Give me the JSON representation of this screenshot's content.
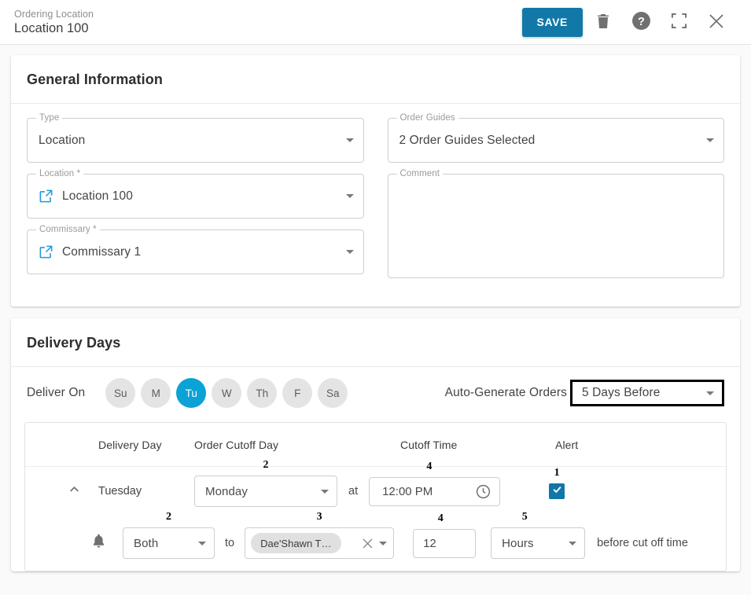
{
  "header": {
    "subtitle": "Ordering Location",
    "title": "Location 100",
    "save_label": "SAVE",
    "icons": {
      "delete": "trash-icon",
      "help": "help-icon",
      "fullscreen": "fullscreen-icon",
      "close": "close-icon"
    }
  },
  "general": {
    "section_title": "General Information",
    "type": {
      "label": "Type",
      "value": "Location"
    },
    "location": {
      "label": "Location *",
      "value": "Location 100"
    },
    "commissary": {
      "label": "Commissary *",
      "value": "Commissary 1"
    },
    "order_guides": {
      "label": "Order Guides",
      "value": "2 Order Guides Selected"
    },
    "comment": {
      "label": "Comment",
      "value": "",
      "placeholder": ""
    }
  },
  "delivery": {
    "section_title": "Delivery Days",
    "deliver_on_label": "Deliver On",
    "days": [
      {
        "label": "Su",
        "selected": false
      },
      {
        "label": "M",
        "selected": false
      },
      {
        "label": "Tu",
        "selected": true
      },
      {
        "label": "W",
        "selected": false
      },
      {
        "label": "Th",
        "selected": false
      },
      {
        "label": "F",
        "selected": false
      },
      {
        "label": "Sa",
        "selected": false
      }
    ],
    "auto_generate": {
      "label": "Auto-Generate Orders",
      "value": "5 Days Before"
    },
    "table": {
      "columns": [
        "Delivery Day",
        "Order Cutoff Day",
        "Cutoff Time",
        "Alert"
      ],
      "row": {
        "delivery_day": "Tuesday",
        "order_cutoff_day": "Monday",
        "at_text": "at",
        "cutoff_time": "12:00 PM",
        "alert_checked": true
      },
      "alert_row": {
        "method": "Both",
        "to_text": "to",
        "recipient_chip": "Dae'Shawn T…",
        "amount": "12",
        "unit": "Hours",
        "suffix_text": "before cut off time"
      }
    }
  },
  "annotations": {
    "one": "1",
    "two": "2",
    "three": "3",
    "four": "4",
    "five": "5"
  },
  "colors": {
    "save_blue": "#1278a8",
    "chip_blue": "#0ba2d6",
    "link_blue": "#1e9bd7",
    "checkbox_blue": "#1176a8"
  }
}
